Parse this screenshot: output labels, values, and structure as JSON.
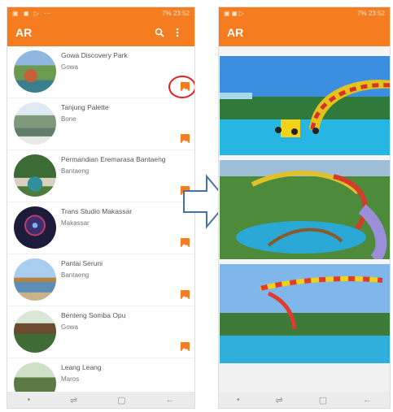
{
  "status": {
    "left_icons": "▣ ◼ ▷ ⋯",
    "right": "7% 23:52"
  },
  "status_right": {
    "right": "7% 23:52"
  },
  "app": {
    "title": "AR"
  },
  "list": [
    {
      "name": "Gowa Discovery Park",
      "location": "Gowa"
    },
    {
      "name": "Tanjung Palette",
      "location": "Bone"
    },
    {
      "name": "Permandian Eremarasa Bantaeng",
      "location": "Bantaeng"
    },
    {
      "name": "Trans Studio Makassar",
      "location": "Makassar"
    },
    {
      "name": "Pantai Seruni",
      "location": "Bantaeng"
    },
    {
      "name": "Benteng Somba Opu",
      "location": "Gowa"
    },
    {
      "name": "Leang Leang",
      "location": "Maros"
    }
  ],
  "colors": {
    "accent": "#f57c1f",
    "highlight": "#e02020"
  },
  "icons": {
    "search": "search-icon",
    "menu": "more-vert-icon",
    "image": "image-icon"
  }
}
